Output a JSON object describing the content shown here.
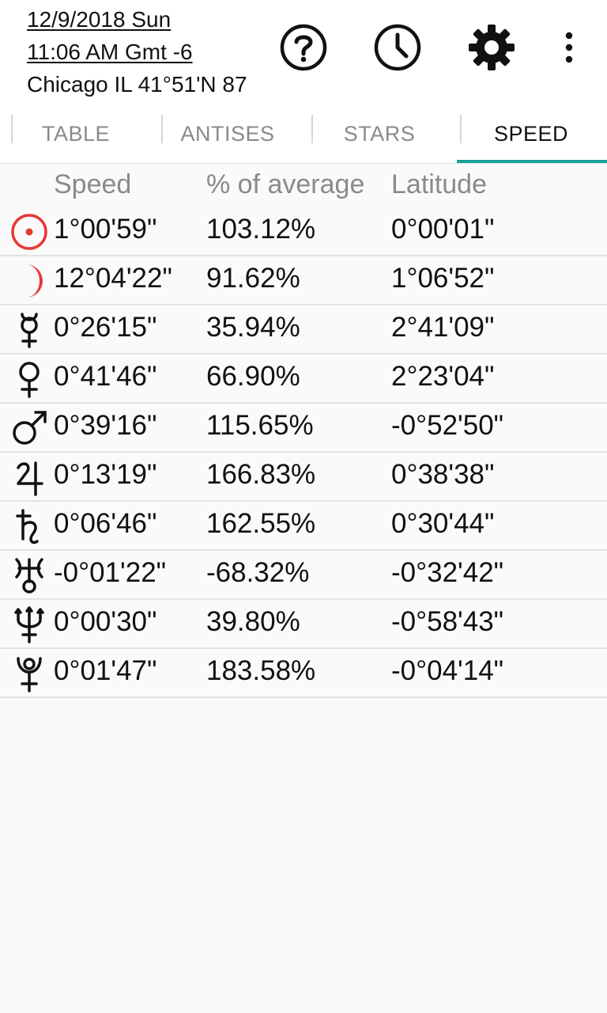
{
  "header": {
    "date": "12/9/2018 Sun",
    "time": "11:06 AM Gmt -6",
    "location": "Chicago IL 41°51'N 87",
    "icons": [
      "help-icon",
      "clock-icon",
      "gear-icon",
      "more-vert-icon"
    ]
  },
  "tabs": [
    {
      "label": "TABLE",
      "active": false
    },
    {
      "label": "ANTISES",
      "active": false
    },
    {
      "label": "STARS",
      "active": false
    },
    {
      "label": "SPEED",
      "active": true
    }
  ],
  "table": {
    "headers": {
      "speed": "Speed",
      "percent": "% of average",
      "latitude": "Latitude"
    },
    "rows": [
      {
        "planet": "sun",
        "speed": "1°00'59\"",
        "percent": "103.12%",
        "latitude": "0°00'01\""
      },
      {
        "planet": "moon",
        "speed": "12°04'22\"",
        "percent": "91.62%",
        "latitude": "1°06'52\""
      },
      {
        "planet": "mercury",
        "speed": "0°26'15\"",
        "percent": "35.94%",
        "latitude": "2°41'09\""
      },
      {
        "planet": "venus",
        "speed": "0°41'46\"",
        "percent": "66.90%",
        "latitude": "2°23'04\""
      },
      {
        "planet": "mars",
        "speed": "0°39'16\"",
        "percent": "115.65%",
        "latitude": "-0°52'50\""
      },
      {
        "planet": "jupiter",
        "speed": "0°13'19\"",
        "percent": "166.83%",
        "latitude": "0°38'38\""
      },
      {
        "planet": "saturn",
        "speed": "0°06'46\"",
        "percent": "162.55%",
        "latitude": "0°30'44\""
      },
      {
        "planet": "uranus",
        "speed": "-0°01'22\"",
        "percent": "-68.32%",
        "latitude": "-0°32'42\""
      },
      {
        "planet": "neptune",
        "speed": "0°00'30\"",
        "percent": "39.80%",
        "latitude": "-0°58'43\""
      },
      {
        "planet": "pluto",
        "speed": "0°01'47\"",
        "percent": "183.58%",
        "latitude": "-0°04'14\""
      }
    ]
  },
  "colors": {
    "accent": "#1aa195",
    "sun_moon_red": "#e53935",
    "header_gray": "#8a8a8a"
  }
}
